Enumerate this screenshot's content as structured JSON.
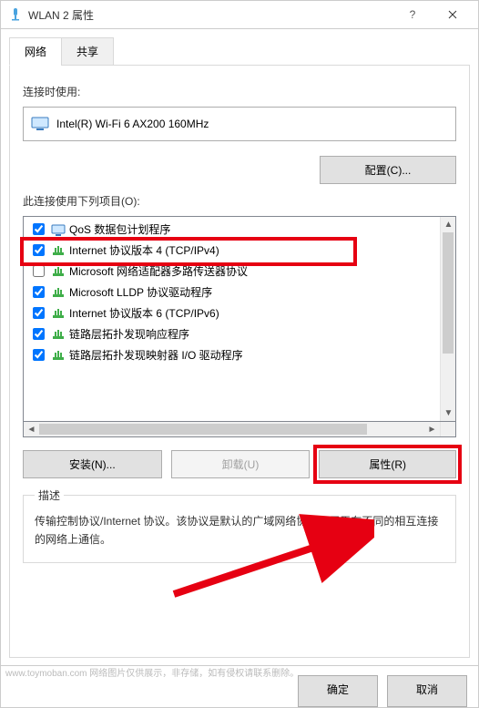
{
  "window": {
    "title": "WLAN 2 属性"
  },
  "tabs": {
    "network": "网络",
    "sharing": "共享"
  },
  "connect_using_label": "连接时使用:",
  "adapter_name": "Intel(R) Wi-Fi 6 AX200 160MHz",
  "configure_btn": "配置(C)...",
  "uses_items_label": "此连接使用下列项目(O):",
  "items": [
    {
      "checked": true,
      "icon": "qos",
      "label": "QoS 数据包计划程序"
    },
    {
      "checked": true,
      "icon": "proto",
      "label": "Internet 协议版本 4 (TCP/IPv4)"
    },
    {
      "checked": false,
      "icon": "proto",
      "label": "Microsoft 网络适配器多路传送器协议"
    },
    {
      "checked": true,
      "icon": "proto",
      "label": "Microsoft LLDP 协议驱动程序"
    },
    {
      "checked": true,
      "icon": "proto",
      "label": "Internet 协议版本 6 (TCP/IPv6)"
    },
    {
      "checked": true,
      "icon": "proto",
      "label": "链路层拓扑发现响应程序"
    },
    {
      "checked": true,
      "icon": "proto",
      "label": "链路层拓扑发现映射器 I/O 驱动程序"
    }
  ],
  "install_btn": "安装(N)...",
  "uninstall_btn": "卸载(U)",
  "properties_btn": "属性(R)",
  "description": {
    "legend": "描述",
    "text": "传输控制协议/Internet 协议。该协议是默认的广域网络协议，用于在不同的相互连接的网络上通信。"
  },
  "ok_btn": "确定",
  "cancel_btn": "取消",
  "watermark": "www.toymoban.com  网络图片仅供展示，非存储，如有侵权请联系删除。",
  "highlight_color": "#e60012"
}
